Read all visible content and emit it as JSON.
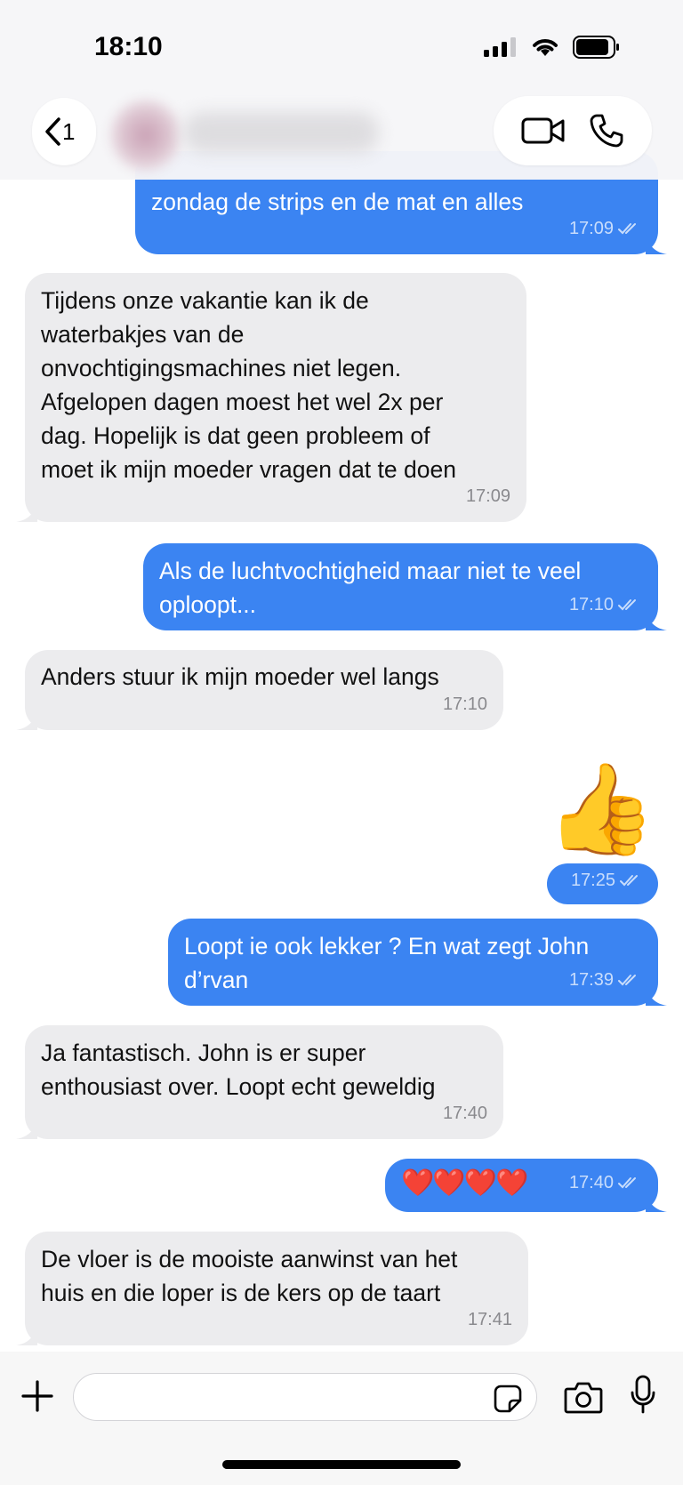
{
  "status_bar": {
    "time": "18:10"
  },
  "header": {
    "back_count": "1",
    "icons": [
      "chevron-left-icon",
      "video-camera-icon",
      "phone-icon"
    ]
  },
  "messages": [
    {
      "direction": "out",
      "text": "zondag de strips en de mat en alles",
      "time": "17:09",
      "read": true
    },
    {
      "direction": "in",
      "text": "Tijdens onze vakantie kan ik de\nwaterbakjes van de\nonvochtigingsmachines niet legen.\nAfgelopen dagen moest het wel 2x per\ndag. Hopelijk is dat geen probleem of\nmoet ik mijn moeder vragen dat te doen",
      "time": "17:09"
    },
    {
      "direction": "out",
      "text": "Als de luchtvochtigheid maar niet te veel\noploopt...",
      "time": "17:10",
      "read": true
    },
    {
      "direction": "in",
      "text": "Anders stuur ik mijn moeder wel langs",
      "time": "17:10"
    },
    {
      "direction": "out",
      "text": "👍",
      "time": "17:25",
      "read": true
    },
    {
      "direction": "out",
      "text": "Loopt ie ook lekker ? En wat zegt John\nd’rvan",
      "time": "17:39",
      "read": true
    },
    {
      "direction": "in",
      "text": "Ja fantastisch. John is er super\nenthousiast over. Loopt echt geweldig",
      "time": "17:40"
    },
    {
      "direction": "out",
      "text": "❤️❤️❤️❤️",
      "time": "17:40",
      "read": true
    },
    {
      "direction": "in",
      "text": "De vloer is de mooiste aanwinst van het\nhuis en die loper is de kers op de taart",
      "time": "17:41"
    }
  ],
  "composer": {
    "placeholder": "",
    "icons": [
      "plus-icon",
      "sticker-icon",
      "camera-icon",
      "microphone-icon"
    ]
  },
  "colors": {
    "outgoing": "#3b84f2",
    "incoming": "#ececee"
  }
}
